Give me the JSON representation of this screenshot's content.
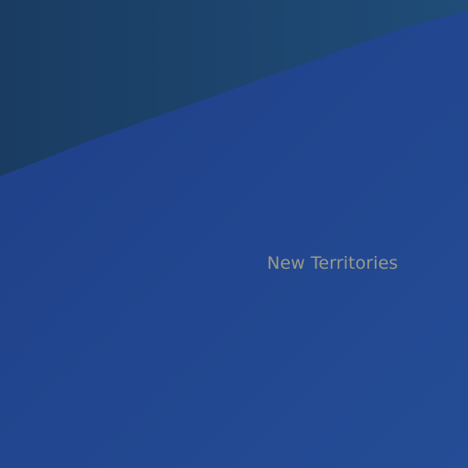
{
  "map": {
    "labels": {
      "region": "New Territories"
    },
    "colors": {
      "land": "#1f3f88",
      "land_right": "#244d96",
      "water_left": "#1a3c62",
      "water_right": "#1f4c78",
      "label_text": "#9a9a8c"
    }
  }
}
